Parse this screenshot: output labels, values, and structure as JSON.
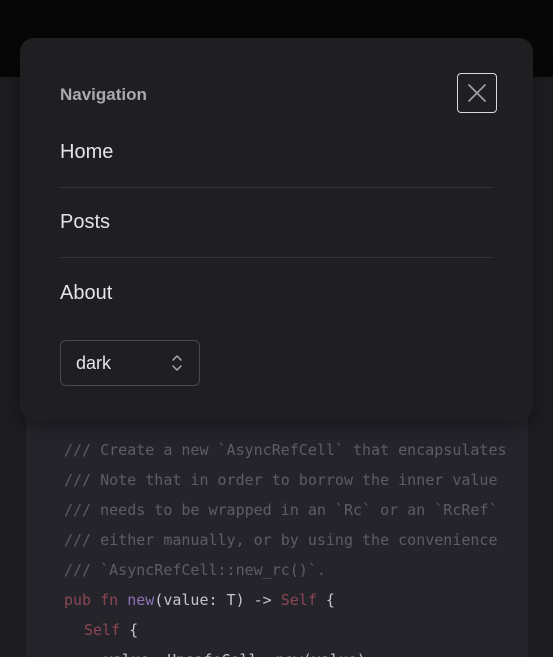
{
  "navigation": {
    "title": "Navigation",
    "close_icon": "close-icon",
    "items": [
      {
        "label": "Home"
      },
      {
        "label": "Posts"
      },
      {
        "label": "About"
      }
    ],
    "theme_select": {
      "value": "dark",
      "icon": "chevron-up-down-icon"
    }
  },
  "code": {
    "lines": [
      "/// Create a new `AsyncRefCell` that encapsulates",
      "/// Note that in order to borrow the inner value",
      "/// needs to be wrapped in an `Rc` or an `RcRef`",
      "/// either manually, or by using the convenience",
      "/// `AsyncRefCell::new_rc()`."
    ],
    "sig": {
      "kw_pub": "pub",
      "kw_fn": "fn",
      "fn_name": "new",
      "params": "(value: T) -> ",
      "ret_self": "Self",
      "brace": " {"
    },
    "body": {
      "self_kw": "Self",
      "brace": " {",
      "partial": "value: UnsafeCell::new(value),"
    }
  },
  "colors": {
    "panel_bg": "#1f1f22",
    "page_bg": "#1d1d20",
    "code_bg": "#26242b",
    "keyword": "#8a4752",
    "function": "#8a71b8",
    "comment": "#5f5b66"
  }
}
